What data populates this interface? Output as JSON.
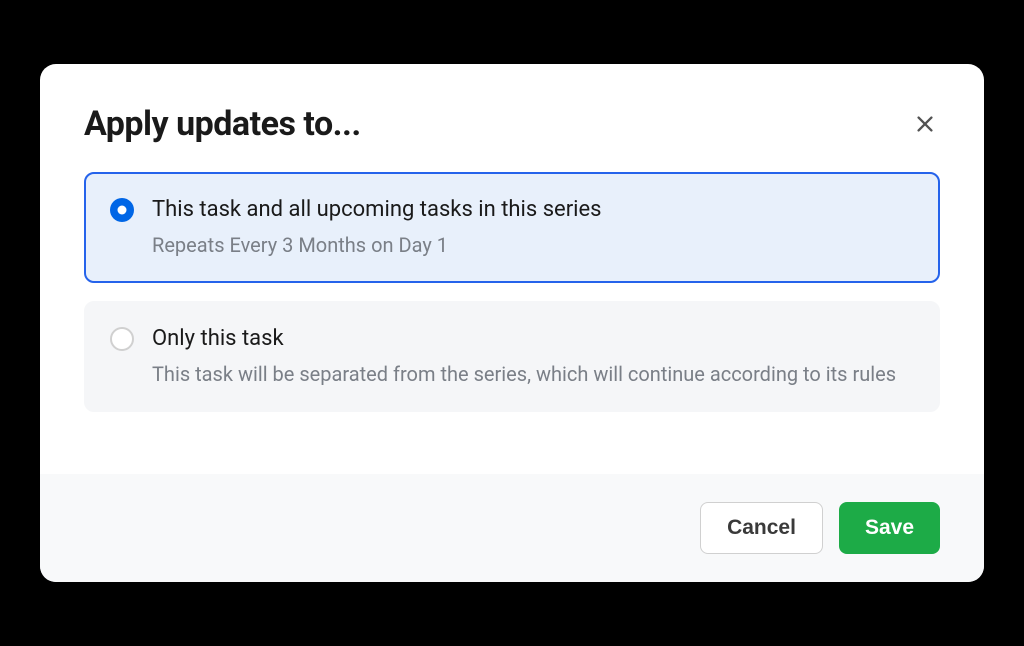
{
  "modal": {
    "title": "Apply updates to...",
    "options": [
      {
        "title": "This task and all upcoming tasks in this series",
        "subtitle": "Repeats Every 3 Months on Day 1",
        "selected": true
      },
      {
        "title": "Only this task",
        "subtitle": "This task will be separated from the series, which will continue according to its rules",
        "selected": false
      }
    ],
    "buttons": {
      "cancel": "Cancel",
      "save": "Save"
    }
  }
}
